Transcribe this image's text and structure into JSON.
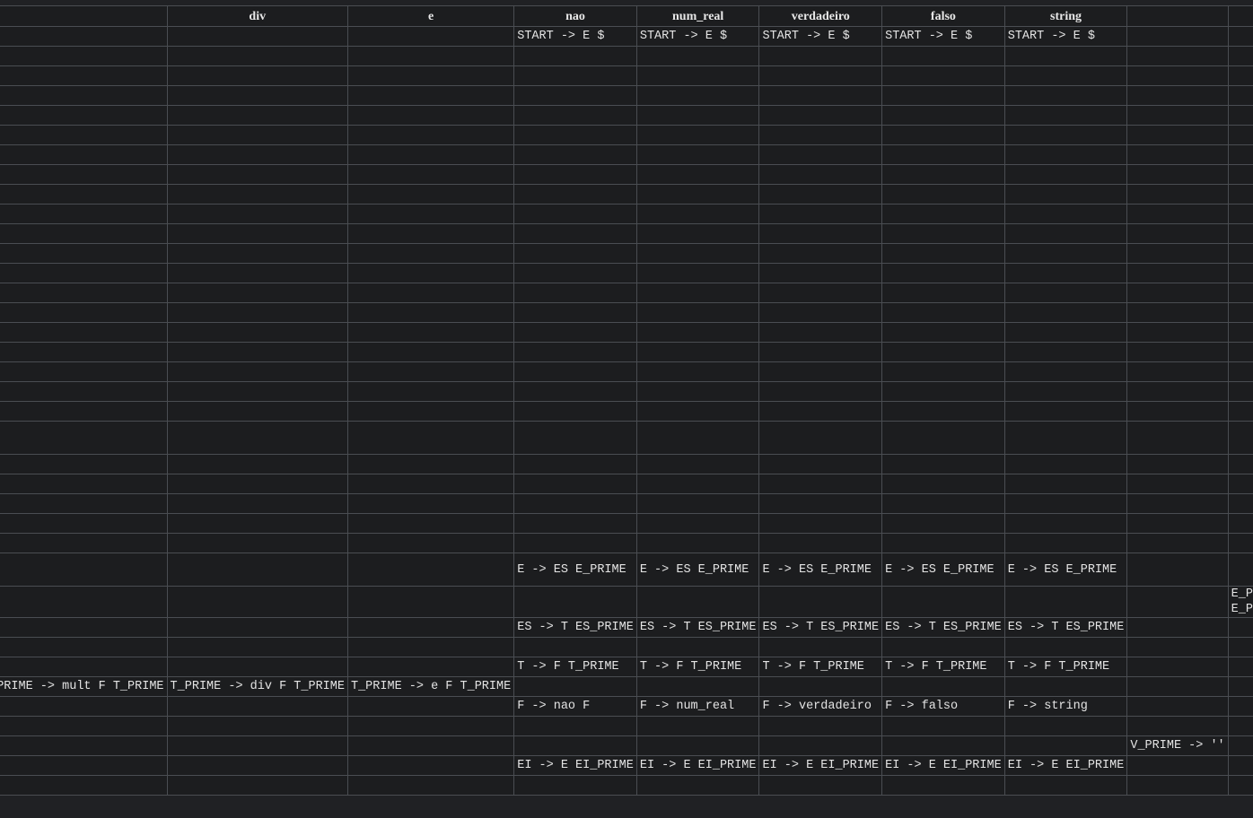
{
  "columns": [
    "",
    "div",
    "e",
    "nao",
    "num_real",
    "verdadeiro",
    "falso",
    "string",
    "",
    "$"
  ],
  "rows": [
    {
      "cells": [
        "",
        "",
        "",
        "START -> E $",
        "START -> E $",
        "START -> E $",
        "START -> E $",
        "START -> E $",
        "",
        ""
      ]
    },
    {
      "cells": [
        "",
        "",
        "",
        "",
        "",
        "",
        "",
        "",
        "",
        ""
      ]
    },
    {
      "cells": [
        "",
        "",
        "",
        "",
        "",
        "",
        "",
        "",
        "",
        ""
      ]
    },
    {
      "cells": [
        "",
        "",
        "",
        "",
        "",
        "",
        "",
        "",
        "",
        ""
      ]
    },
    {
      "cells": [
        "",
        "",
        "",
        "",
        "",
        "",
        "",
        "",
        "",
        ""
      ]
    },
    {
      "cells": [
        "",
        "",
        "",
        "",
        "",
        "",
        "",
        "",
        "",
        ""
      ]
    },
    {
      "cells": [
        "",
        "",
        "",
        "",
        "",
        "",
        "",
        "",
        "",
        ""
      ]
    },
    {
      "cells": [
        "",
        "",
        "",
        "",
        "",
        "",
        "",
        "",
        "",
        ""
      ]
    },
    {
      "cells": [
        "",
        "",
        "",
        "",
        "",
        "",
        "",
        "",
        "",
        ""
      ]
    },
    {
      "cells": [
        "",
        "",
        "",
        "",
        "",
        "",
        "",
        "",
        "",
        ""
      ]
    },
    {
      "cells": [
        "",
        "",
        "",
        "",
        "",
        "",
        "",
        "",
        "",
        ""
      ]
    },
    {
      "cells": [
        "",
        "",
        "",
        "",
        "",
        "",
        "",
        "",
        "",
        ""
      ]
    },
    {
      "cells": [
        "",
        "",
        "",
        "",
        "",
        "",
        "",
        "",
        "",
        ""
      ]
    },
    {
      "cells": [
        "",
        "",
        "",
        "",
        "",
        "",
        "",
        "",
        "",
        ""
      ]
    },
    {
      "cells": [
        "",
        "",
        "",
        "",
        "",
        "",
        "",
        "",
        "",
        ""
      ]
    },
    {
      "cells": [
        "",
        "",
        "",
        "",
        "",
        "",
        "",
        "",
        "",
        ""
      ]
    },
    {
      "cells": [
        "",
        "",
        "",
        "",
        "",
        "",
        "",
        "",
        "",
        ""
      ]
    },
    {
      "cells": [
        "",
        "",
        "",
        "",
        "",
        "",
        "",
        "",
        "",
        ""
      ]
    },
    {
      "cells": [
        "",
        "",
        "",
        "",
        "",
        "",
        "",
        "",
        "",
        ""
      ]
    },
    {
      "cells": [
        "",
        "",
        "",
        "",
        "",
        "",
        "",
        "",
        "",
        ""
      ]
    },
    {
      "cells": [
        "",
        "",
        "",
        "",
        "",
        "",
        "",
        "",
        "",
        ""
      ]
    },
    {
      "cells": [
        "",
        "",
        "",
        "",
        "",
        "",
        "",
        "",
        "",
        ""
      ]
    },
    {
      "cells": [
        "",
        "",
        "",
        "",
        "",
        "",
        "",
        "",
        "",
        ""
      ]
    },
    {
      "cells": [
        "",
        "",
        "",
        "",
        "",
        "",
        "",
        "",
        "",
        ""
      ]
    },
    {
      "cells": [
        "",
        "",
        "",
        "",
        "",
        "",
        "",
        "",
        "",
        ""
      ]
    },
    {
      "cells": [
        "",
        "",
        "",
        "",
        "",
        "",
        "",
        "",
        "",
        ""
      ]
    },
    {
      "cells": [
        "",
        "",
        "",
        "E -> ES E_PRIME",
        "E -> ES E_PRIME",
        "E -> ES E_PRIME",
        "E -> ES E_PRIME",
        "E -> ES E_PRIME",
        "",
        ""
      ]
    },
    {
      "cells": [
        "",
        "",
        "",
        "",
        "",
        "",
        "",
        "",
        "",
        "E_PRIME -> ''\nE_PRIME -> ''"
      ]
    },
    {
      "cells": [
        "",
        "",
        "",
        "ES -> T ES_PRIME",
        "ES -> T ES_PRIME",
        "ES -> T ES_PRIME",
        "ES -> T ES_PRIME",
        "ES -> T ES_PRIME",
        "",
        ""
      ]
    },
    {
      "cells": [
        "",
        "",
        "",
        "",
        "",
        "",
        "",
        "",
        "",
        ""
      ]
    },
    {
      "cells": [
        "",
        "",
        "",
        "T -> F T_PRIME",
        "T -> F T_PRIME",
        "T -> F T_PRIME",
        "T -> F T_PRIME",
        "T -> F T_PRIME",
        "",
        ""
      ]
    },
    {
      "cells": [
        "T_PRIME -> mult F T_PRIME",
        "T_PRIME -> div F T_PRIME",
        "T_PRIME -> e F T_PRIME",
        "",
        "",
        "",
        "",
        "",
        "",
        ""
      ]
    },
    {
      "cells": [
        "",
        "",
        "",
        "F -> nao F",
        "F -> num_real",
        "F -> verdadeiro",
        "F -> falso",
        "F -> string",
        "",
        ""
      ]
    },
    {
      "cells": [
        "",
        "",
        "",
        "",
        "",
        "",
        "",
        "",
        "",
        ""
      ]
    },
    {
      "cells": [
        "",
        "",
        "",
        "",
        "",
        "",
        "",
        "",
        "V_PRIME -> ''",
        ""
      ]
    },
    {
      "cells": [
        "",
        "",
        "",
        "EI -> E EI_PRIME",
        "EI -> E EI_PRIME",
        "EI -> E EI_PRIME",
        "EI -> E EI_PRIME",
        "EI -> E EI_PRIME",
        "",
        ""
      ]
    },
    {
      "cells": [
        "",
        "",
        "",
        "",
        "",
        "",
        "",
        "",
        "",
        ""
      ]
    }
  ]
}
